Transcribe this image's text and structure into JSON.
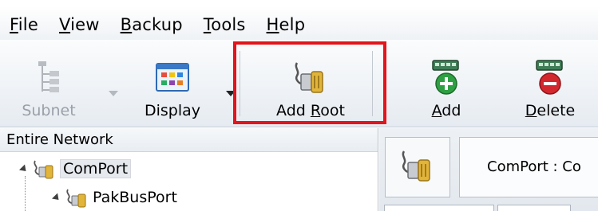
{
  "menu": {
    "items": [
      {
        "label": "File",
        "key": "F",
        "rest": "ile"
      },
      {
        "label": "View",
        "key": "V",
        "rest": "iew"
      },
      {
        "label": "Backup",
        "key": "B",
        "rest": "ackup"
      },
      {
        "label": "Tools",
        "key": "T",
        "rest": "ools"
      },
      {
        "label": "Help",
        "key": "H",
        "rest": "elp"
      }
    ]
  },
  "toolbar": {
    "subnet_label": "Subnet",
    "display_label": "Display",
    "add_root_prefix": "Add ",
    "add_root_key": "R",
    "add_root_rest": "oot",
    "add_key": "A",
    "add_rest": "dd",
    "delete_key": "D",
    "delete_rest": "elete"
  },
  "tree": {
    "header": "Entire Network",
    "nodes": [
      {
        "label": "ComPort",
        "selected": true
      },
      {
        "label": "PakBusPort",
        "selected": false
      }
    ]
  },
  "details": {
    "title": "ComPort : Co"
  },
  "colors": {
    "highlight": "#e3141b",
    "add_green": "#2ea043",
    "delete_red": "#d3272e"
  }
}
